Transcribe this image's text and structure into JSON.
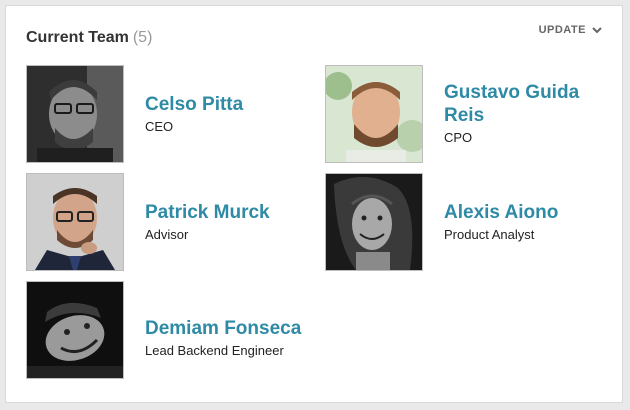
{
  "header": {
    "title": "Current Team",
    "count": "(5)",
    "update_label": "UPDATE"
  },
  "members": [
    {
      "name": "Celso Pitta",
      "role": "CEO"
    },
    {
      "name": "Gustavo Guida Reis",
      "role": "CPO"
    },
    {
      "name": "Patrick Murck",
      "role": "Advisor"
    },
    {
      "name": "Alexis Aiono",
      "role": "Product Analyst"
    },
    {
      "name": "Demiam Fonseca",
      "role": "Lead Backend Engineer"
    }
  ],
  "colors": {
    "name": "#2f8aa5",
    "title": "#333333",
    "count": "#9a9a9a"
  }
}
